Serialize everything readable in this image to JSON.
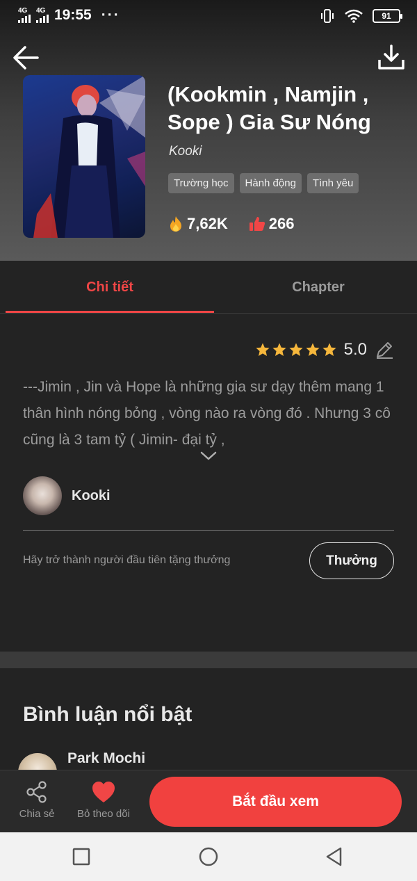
{
  "status_bar": {
    "network_1": "4G",
    "network_2": "4G",
    "time": "19:55",
    "dots": "···",
    "battery": "91"
  },
  "header": {
    "title": "(Kookmin , Namjin , Sope ) Gia Sư Nóng",
    "author": "Kooki",
    "tags": [
      "Trường học",
      "Hành động",
      "Tình yêu"
    ],
    "views": "7,62K",
    "likes": "266",
    "icons": {
      "back": "arrow-left-icon",
      "download": "download-icon",
      "views": "fire-icon",
      "likes": "thumbs-up-icon"
    }
  },
  "tabs": [
    {
      "label": "Chi tiết",
      "active": true
    },
    {
      "label": "Chapter",
      "active": false
    }
  ],
  "detail": {
    "rating": "5.0",
    "stars": 5,
    "description": "---Jimin , Jin và Hope là những gia sư dạy thêm mang 1 thân hình nóng bỏng , vòng nào ra vòng đó . Nhưng 3 cô cũng là 3 tam tỷ ( Jimin- đại tỷ ,",
    "uploader": "Kooki",
    "reward_text": "Hãy trở thành người đầu tiên tặng thưởng",
    "reward_button": "Thưởng"
  },
  "comments": {
    "title": "Bình luận nổi bật",
    "first_user": "Park Mochi"
  },
  "action_bar": {
    "share": "Chia sẻ",
    "unfollow": "Bỏ theo dõi",
    "start": "Bắt đầu xem"
  },
  "colors": {
    "accent": "#f04646",
    "star": "#f6b73c",
    "background": "#232323"
  }
}
